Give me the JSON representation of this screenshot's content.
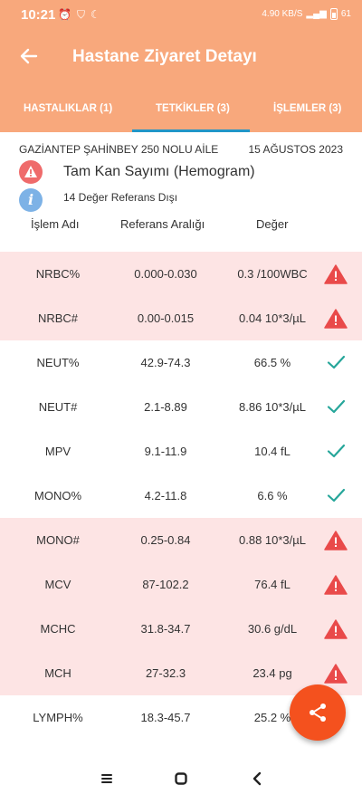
{
  "status_bar": {
    "time": "10:21",
    "indicators": [
      "alarm-icon",
      "vpn-shield-icon",
      "moon-icon"
    ],
    "network": "4.90 KB/S",
    "battery": "61"
  },
  "app_bar": {
    "title": "Hastane Ziyaret Detayı",
    "back_icon": "arrow-left-icon"
  },
  "tabs": [
    {
      "label": "HASTALIKLAR (1)",
      "selected": false
    },
    {
      "label": "TETKİKLER (3)",
      "selected": true
    },
    {
      "label": "İŞLEMLER (3)",
      "selected": false
    }
  ],
  "visit": {
    "facility": "GAZİANTEP ŞAHİNBEY 250 NOLU AİLE",
    "date": "15 AĞUSTOS 2023",
    "test_name": "Tam Kan Sayımı (Hemogram)",
    "out_of_range": "14 Değer Referans Dışı"
  },
  "table": {
    "headers": [
      "İşlem Adı",
      "Referans Aralığı",
      "Değer"
    ],
    "rows": [
      {
        "name": "NRBC%",
        "range": "0.000-0.030",
        "value": "0.3 /100WBC",
        "status": "out"
      },
      {
        "name": "NRBC#",
        "range": "0.00-0.015",
        "value": "0.04 10*3/µL",
        "status": "out"
      },
      {
        "name": "NEUT%",
        "range": "42.9-74.3",
        "value": "66.5 %",
        "status": "ok"
      },
      {
        "name": "NEUT#",
        "range": "2.1-8.89",
        "value": "8.86 10*3/µL",
        "status": "ok"
      },
      {
        "name": "MPV",
        "range": "9.1-11.9",
        "value": "10.4 fL",
        "status": "ok"
      },
      {
        "name": "MONO%",
        "range": "4.2-11.8",
        "value": "6.6 %",
        "status": "ok"
      },
      {
        "name": "MONO#",
        "range": "0.25-0.84",
        "value": "0.88 10*3/µL",
        "status": "out"
      },
      {
        "name": "MCV",
        "range": "87-102.2",
        "value": "76.4 fL",
        "status": "out"
      },
      {
        "name": "MCHC",
        "range": "31.8-34.7",
        "value": "30.6 g/dL",
        "status": "out"
      },
      {
        "name": "MCH",
        "range": "27-32.3",
        "value": "23.4 pg",
        "status": "out"
      },
      {
        "name": "LYMPH%",
        "range": "18.3-45.7",
        "value": "25.2 %",
        "status": "ok"
      }
    ]
  },
  "fab": {
    "icon": "share-icon"
  },
  "nav_bar": [
    "recents-icon",
    "home-icon",
    "back-chevron-icon"
  ],
  "colors": {
    "primary": "#f8a87c",
    "indicator": "#2196c8",
    "out_of_range_bg": "#fde4e4",
    "warning": "#e94a4a",
    "ok": "#26a69a",
    "fab": "#f4511e"
  }
}
